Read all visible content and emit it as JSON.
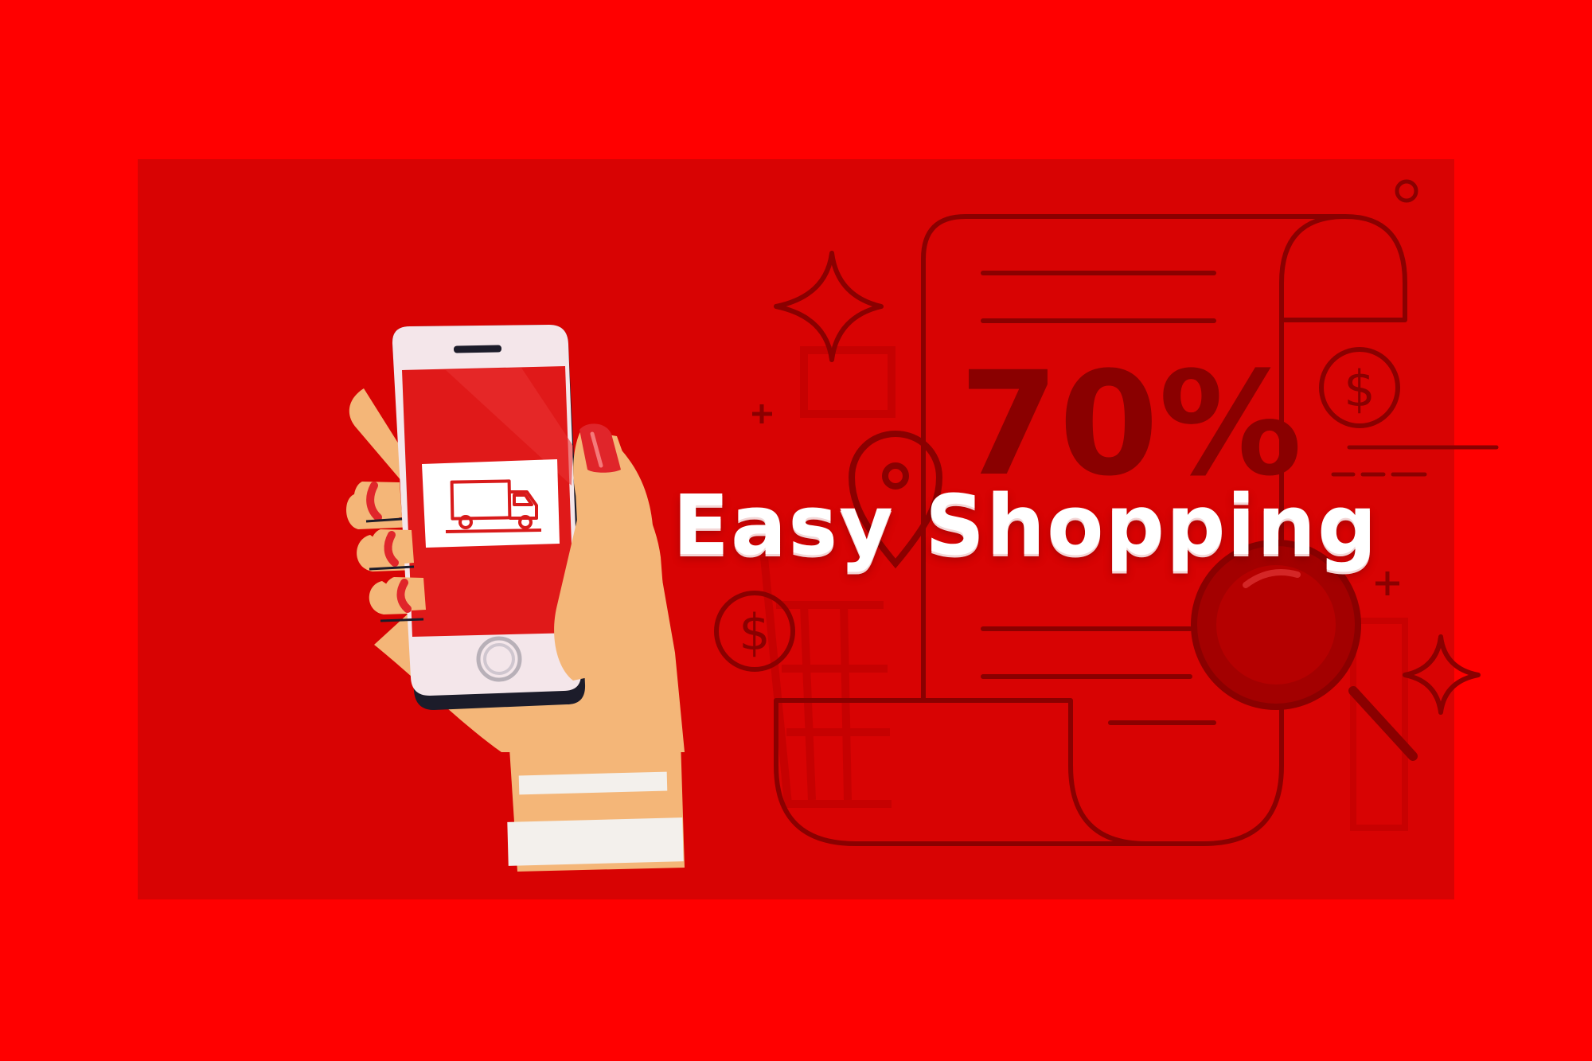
{
  "banner": {
    "headline": "Easy Shopping",
    "discount": "70%",
    "currency_symbol": "$"
  },
  "colors": {
    "frame": "#ff0000",
    "panel": "#d80303",
    "line_art": "#8a0000",
    "headline": "#ffffff",
    "skin": "#f4b678",
    "nail": "#e0252a",
    "phone_body": "#f4e6ea",
    "phone_screen": "#e01919"
  },
  "icons": [
    "delivery-truck-icon",
    "receipt-icon",
    "magnifier-icon",
    "location-pin-icon",
    "dollar-coin-icon",
    "sparkle-icon",
    "shopping-cart-icon"
  ]
}
